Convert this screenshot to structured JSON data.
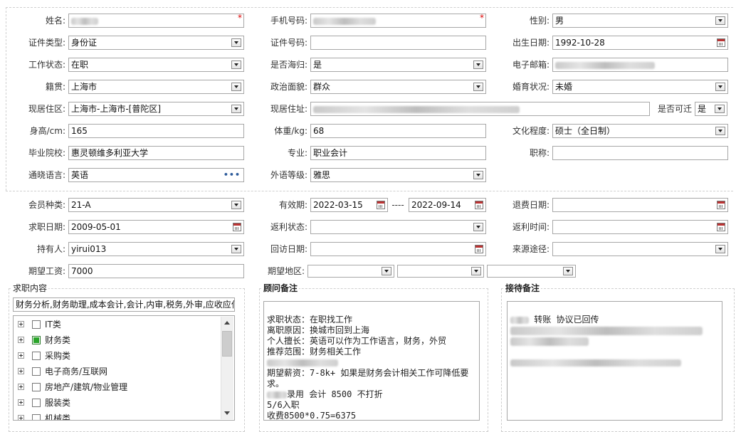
{
  "required_mark": "*",
  "personal": {
    "name": {
      "label": "姓名:",
      "value": ""
    },
    "phone": {
      "label": "手机号码:",
      "value": ""
    },
    "gender": {
      "label": "性别:",
      "value": "男"
    },
    "id_type": {
      "label": "证件类型:",
      "value": "身份证"
    },
    "id_number": {
      "label": "证件号码:",
      "value": ""
    },
    "birth_date": {
      "label": "出生日期:",
      "value": "1992-10-28"
    },
    "work_status": {
      "label": "工作状态:",
      "value": "在职"
    },
    "returnee": {
      "label": "是否海归:",
      "value": "是"
    },
    "email": {
      "label": "电子邮箱:",
      "value": ""
    },
    "native_place": {
      "label": "籍贯:",
      "value": "上海市"
    },
    "political": {
      "label": "政治面貌:",
      "value": "群众"
    },
    "marital": {
      "label": "婚育状况:",
      "value": "未婚"
    },
    "residence_area": {
      "label": "现居住区:",
      "value": "上海市-上海市-[普陀区]"
    },
    "address": {
      "label": "现居住址:",
      "value": ""
    },
    "relocatable": {
      "label": "是否可迁",
      "value": "是"
    },
    "height": {
      "label": "身高/cm:",
      "value": "165"
    },
    "weight": {
      "label": "体重/kg:",
      "value": "68"
    },
    "education": {
      "label": "文化程度:",
      "value": "硕士（全日制）"
    },
    "school": {
      "label": "毕业院校:",
      "value": "惠灵顿维多利亚大学"
    },
    "major": {
      "label": "专业:",
      "value": "职业会计"
    },
    "title": {
      "label": "职称:",
      "value": ""
    },
    "language": {
      "label": "通晓语言:",
      "value": "英语",
      "more": "•••"
    },
    "lang_level": {
      "label": "外语等级:",
      "value": "雅思"
    }
  },
  "membership": {
    "type": {
      "label": "会员种类:",
      "value": "21-A"
    },
    "valid": {
      "label": "有效期:",
      "from": "2022-03-15",
      "sep": "----",
      "to": "2022-09-14"
    },
    "refund_date": {
      "label": "退费日期:",
      "value": ""
    },
    "job_date": {
      "label": "求职日期:",
      "value": "2009-05-01"
    },
    "rebate_status": {
      "label": "返利状态:",
      "value": ""
    },
    "rebate_time": {
      "label": "返利时间:",
      "value": ""
    },
    "holder": {
      "label": "持有人:",
      "value": "yirui013"
    },
    "visit_date": {
      "label": "回访日期:",
      "value": ""
    },
    "source": {
      "label": "来源途径:",
      "value": ""
    },
    "salary": {
      "label": "期望工资:",
      "value": "7000"
    },
    "region": {
      "label": "期望地区:",
      "values": [
        "",
        "",
        ""
      ]
    }
  },
  "job_panel": {
    "title": "求职内容",
    "summary": "财务分析,财务助理,成本会计,会计,内审,税务,外审,应收应付",
    "tree": [
      {
        "label": "IT类",
        "checked": false
      },
      {
        "label": "财务类",
        "checked": true
      },
      {
        "label": "采购类",
        "checked": false
      },
      {
        "label": "电子商务/互联网",
        "checked": false
      },
      {
        "label": "房地产/建筑/物业管理",
        "checked": false
      },
      {
        "label": "服装类",
        "checked": false
      },
      {
        "label": "机械类",
        "checked": false
      }
    ]
  },
  "advisor_panel": {
    "title": "顾问备注",
    "lines": [
      "求职状态：在职找工作",
      "离职原因：换城市回到上海",
      "个人擅长：英语可以作为工作语言，财务，外贸",
      "推荐范围：财务相关工作",
      "",
      "期望薪资：7-8k+ 如果是财务会计相关工作可降低要求。",
      "录用 会计 8500 不打折",
      "5/6入职",
      "收费8500*0.75=6375"
    ]
  },
  "reception_panel": {
    "title": "接待备注",
    "first_line": "转账 协议已回传"
  }
}
